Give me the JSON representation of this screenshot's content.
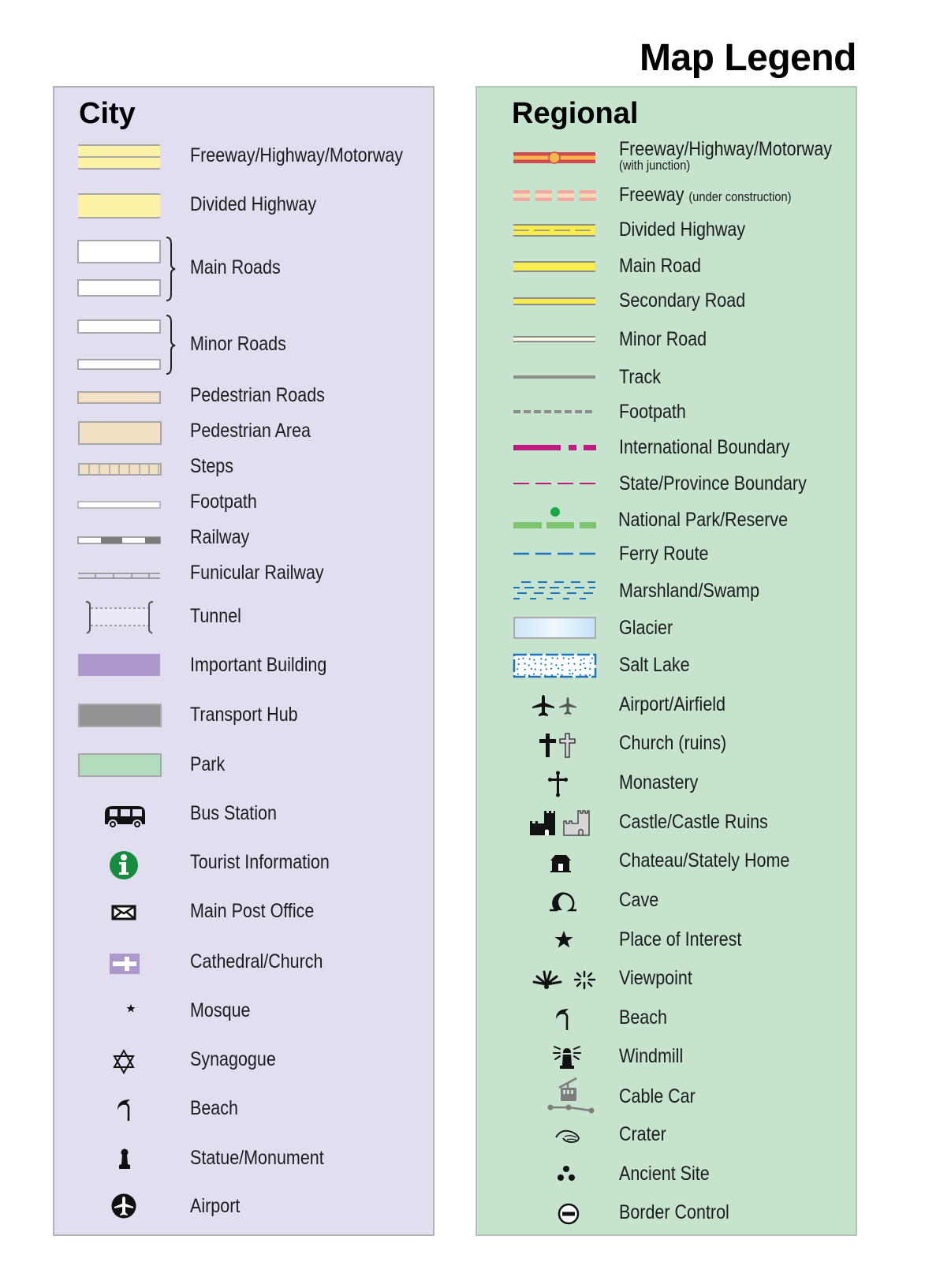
{
  "title": "Map Legend",
  "city": {
    "heading": "City",
    "items": [
      {
        "label": "Freeway/Highway/Motorway",
        "icon": "freeway-line"
      },
      {
        "label": "Divided Highway",
        "icon": "divided-highway-line"
      },
      {
        "label": "Main Roads",
        "icon": "main-roads-lines"
      },
      {
        "label": "Minor Roads",
        "icon": "minor-roads-lines"
      },
      {
        "label": "Pedestrian Roads",
        "icon": "pedestrian-road-line"
      },
      {
        "label": "Pedestrian Area",
        "icon": "pedestrian-area-swatch"
      },
      {
        "label": "Steps",
        "icon": "steps-line"
      },
      {
        "label": "Footpath",
        "icon": "footpath-line"
      },
      {
        "label": "Railway",
        "icon": "railway-line"
      },
      {
        "label": "Funicular Railway",
        "icon": "funicular-line"
      },
      {
        "label": "Tunnel",
        "icon": "tunnel-line"
      },
      {
        "label": "Important Building",
        "icon": "important-building-swatch"
      },
      {
        "label": "Transport Hub",
        "icon": "transport-hub-swatch"
      },
      {
        "label": "Park",
        "icon": "park-swatch"
      },
      {
        "label": "Bus Station",
        "icon": "bus-icon"
      },
      {
        "label": "Tourist Information",
        "icon": "info-icon"
      },
      {
        "label": "Main Post Office",
        "icon": "envelope-icon"
      },
      {
        "label": "Cathedral/Church",
        "icon": "church-icon"
      },
      {
        "label": "Mosque",
        "icon": "crescent-star-icon"
      },
      {
        "label": "Synagogue",
        "icon": "star-of-david-icon"
      },
      {
        "label": "Beach",
        "icon": "umbrella-icon"
      },
      {
        "label": "Statue/Monument",
        "icon": "monument-icon"
      },
      {
        "label": "Airport",
        "icon": "airport-icon"
      }
    ]
  },
  "regional": {
    "heading": "Regional",
    "items": [
      {
        "label": "Freeway/Highway/Motorway",
        "sublabel": "(with junction)",
        "icon": "freeway-junction-line"
      },
      {
        "label": "Freeway",
        "sublabel": "(under construction)",
        "icon": "freeway-construction-line"
      },
      {
        "label": "Divided Highway",
        "icon": "divided-highway-line"
      },
      {
        "label": "Main Road",
        "icon": "main-road-line"
      },
      {
        "label": "Secondary Road",
        "icon": "secondary-road-line"
      },
      {
        "label": "Minor Road",
        "icon": "minor-road-line"
      },
      {
        "label": "Track",
        "icon": "track-line"
      },
      {
        "label": "Footpath",
        "icon": "footpath-dashed-line"
      },
      {
        "label": "International Boundary",
        "icon": "international-boundary-line"
      },
      {
        "label": "State/Province Boundary",
        "icon": "state-boundary-line"
      },
      {
        "label": "National Park/Reserve",
        "icon": "national-park-line"
      },
      {
        "label": "Ferry Route",
        "icon": "ferry-route-line"
      },
      {
        "label": "Marshland/Swamp",
        "icon": "marsh-pattern"
      },
      {
        "label": "Glacier",
        "icon": "glacier-swatch"
      },
      {
        "label": "Salt Lake",
        "icon": "salt-lake-swatch"
      },
      {
        "label": "Airport/Airfield",
        "icon": "airplane-icon"
      },
      {
        "label": "Church (ruins)",
        "icon": "cross-icon"
      },
      {
        "label": "Monastery",
        "icon": "monastery-cross-icon"
      },
      {
        "label": "Castle/Castle Ruins",
        "icon": "castle-icon"
      },
      {
        "label": "Chateau/Stately Home",
        "icon": "chateau-icon"
      },
      {
        "label": "Cave",
        "icon": "cave-icon"
      },
      {
        "label": "Place of Interest",
        "icon": "star-icon"
      },
      {
        "label": "Viewpoint",
        "icon": "viewpoint-icon"
      },
      {
        "label": "Beach",
        "icon": "umbrella-icon"
      },
      {
        "label": "Windmill",
        "icon": "windmill-icon"
      },
      {
        "label": "Cable Car",
        "icon": "cable-car-icon"
      },
      {
        "label": "Crater",
        "icon": "crater-icon"
      },
      {
        "label": "Ancient Site",
        "icon": "ancient-site-icon"
      },
      {
        "label": "Border Control",
        "icon": "border-control-icon"
      }
    ]
  },
  "colors": {
    "city_bg": "#e1def0",
    "regional_bg": "#c5e3cd",
    "freeway_yellow": "#fdf3a6",
    "road_outline": "#a8a8a8",
    "pedestrian": "#f1e0c4",
    "important_building": "#ad98cb",
    "transport_hub": "#949497",
    "park": "#b2dcbe",
    "tourist_info_green": "#178c3f",
    "motorway_red": "#cf4b4f",
    "motorway_orange": "#f7b84c",
    "construction_pink": "#f3a9a0",
    "road_yellow": "#f9ec4f",
    "boundary_magenta": "#c0197f",
    "park_green": "#7fc46e",
    "ferry_blue": "#1e73c0",
    "glacier_blue": "#cce6f6"
  }
}
